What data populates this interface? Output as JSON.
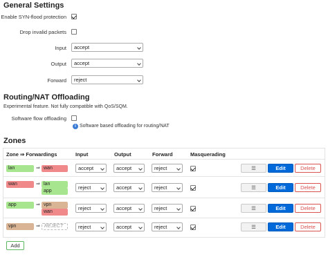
{
  "general": {
    "title": "General Settings",
    "syn_label": "Enable SYN-flood protection",
    "syn_checked": true,
    "drop_label": "Drop invalid packets",
    "drop_checked": false,
    "input_label": "Input",
    "input_value": "accept",
    "output_label": "Output",
    "output_value": "accept",
    "forward_label": "Forward",
    "forward_value": "reject"
  },
  "offload": {
    "title": "Routing/NAT Offloading",
    "description": "Experimental feature. Not fully compatible with QoS/SQM.",
    "flow_label": "Software flow offloading",
    "flow_checked": false,
    "flow_hint": "Software based offloading for routing/NAT"
  },
  "zones": {
    "title": "Zones",
    "headers": {
      "zone": "Zone ⇒ Forwardings",
      "input": "Input",
      "output": "Output",
      "forward": "Forward",
      "masq": "Masquerading"
    },
    "arrow": "⇒",
    "rows": [
      {
        "zone": "lan",
        "zone_color": "#a7e58e",
        "fwd": [
          "wan"
        ],
        "input": "accept",
        "output": "accept",
        "forward": "reject",
        "masq": true
      },
      {
        "zone": "wan",
        "zone_color": "#f08a8a",
        "fwd": [
          "lan",
          "app"
        ],
        "input": "reject",
        "output": "accept",
        "forward": "reject",
        "masq": true
      },
      {
        "zone": "app",
        "zone_color": "#a7e58e",
        "fwd": [
          "vpn",
          "wan"
        ],
        "input": "reject",
        "output": "accept",
        "forward": "reject",
        "masq": true
      },
      {
        "zone": "vpn",
        "zone_color": "#d9b596",
        "fwd": [
          "REJECT"
        ],
        "input": "reject",
        "output": "accept",
        "forward": "reject",
        "masq": true
      }
    ],
    "menu_label": "☰",
    "edit_label": "Edit",
    "delete_label": "Delete",
    "add_label": "Add"
  }
}
